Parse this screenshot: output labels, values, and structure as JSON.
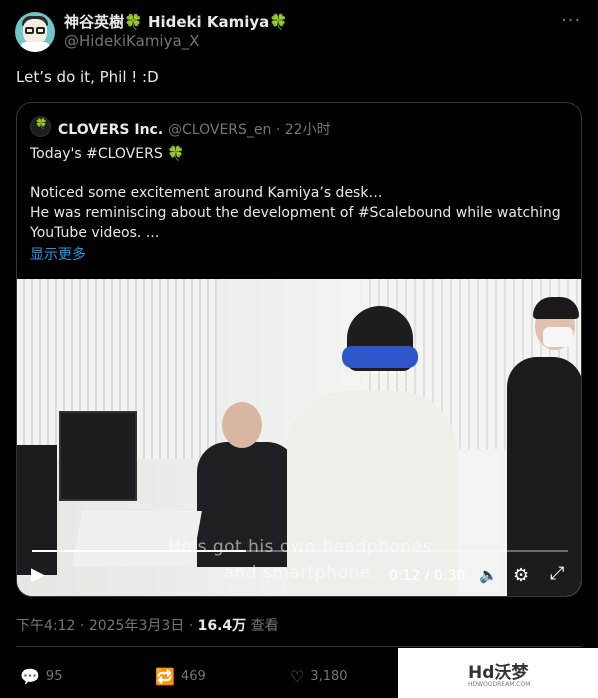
{
  "author": {
    "display_name": "神谷英樹",
    "display_name_en": "Hideki Kamiya",
    "clover": "🍀",
    "handle": "@HidekiKamiya_X"
  },
  "more_icon": "···",
  "tweet_text": "Let’s do it, Phil ! :D",
  "quote": {
    "avatar_label": "🍀",
    "name": "CLOVERS Inc.",
    "handle": "@CLOVERS_en",
    "separator": " · ",
    "time": "22小时",
    "lines": [
      "Today's #CLOVERS 🍀",
      "Noticed some excitement around Kamiya’s desk…",
      "He was reminiscing about the development of #Scalebound while watching",
      "YouTube videos.  ..."
    ],
    "show_more": "显示更多"
  },
  "video": {
    "caption_line1": "He's got his own headphones",
    "caption_line2": "and smartphone.",
    "time": "0:12 / 0:30",
    "progress": 0.4,
    "play_icon": "▶",
    "volume_icon": "🔈",
    "settings_icon": "⚙",
    "fullscreen_icon": "⤢"
  },
  "meta": {
    "time": "下午4:12",
    "separator": " · ",
    "date": "2025年3月3日",
    "views": "16.4万",
    "views_label": "查看"
  },
  "actions": {
    "replies": "95",
    "reposts": "469",
    "likes": "3,180",
    "reply_icon": "💬",
    "repost_icon": "🔁",
    "like_icon": "♡"
  },
  "watermark": {
    "title": "Hd沃梦",
    "subtitle": "HDWOODREAM.COM"
  },
  "colors": {
    "background": "#000000",
    "text": "#e7e9ea",
    "muted": "#71767b",
    "link": "#1d9bf0",
    "clover": "#37b24d",
    "border": "#333639"
  }
}
